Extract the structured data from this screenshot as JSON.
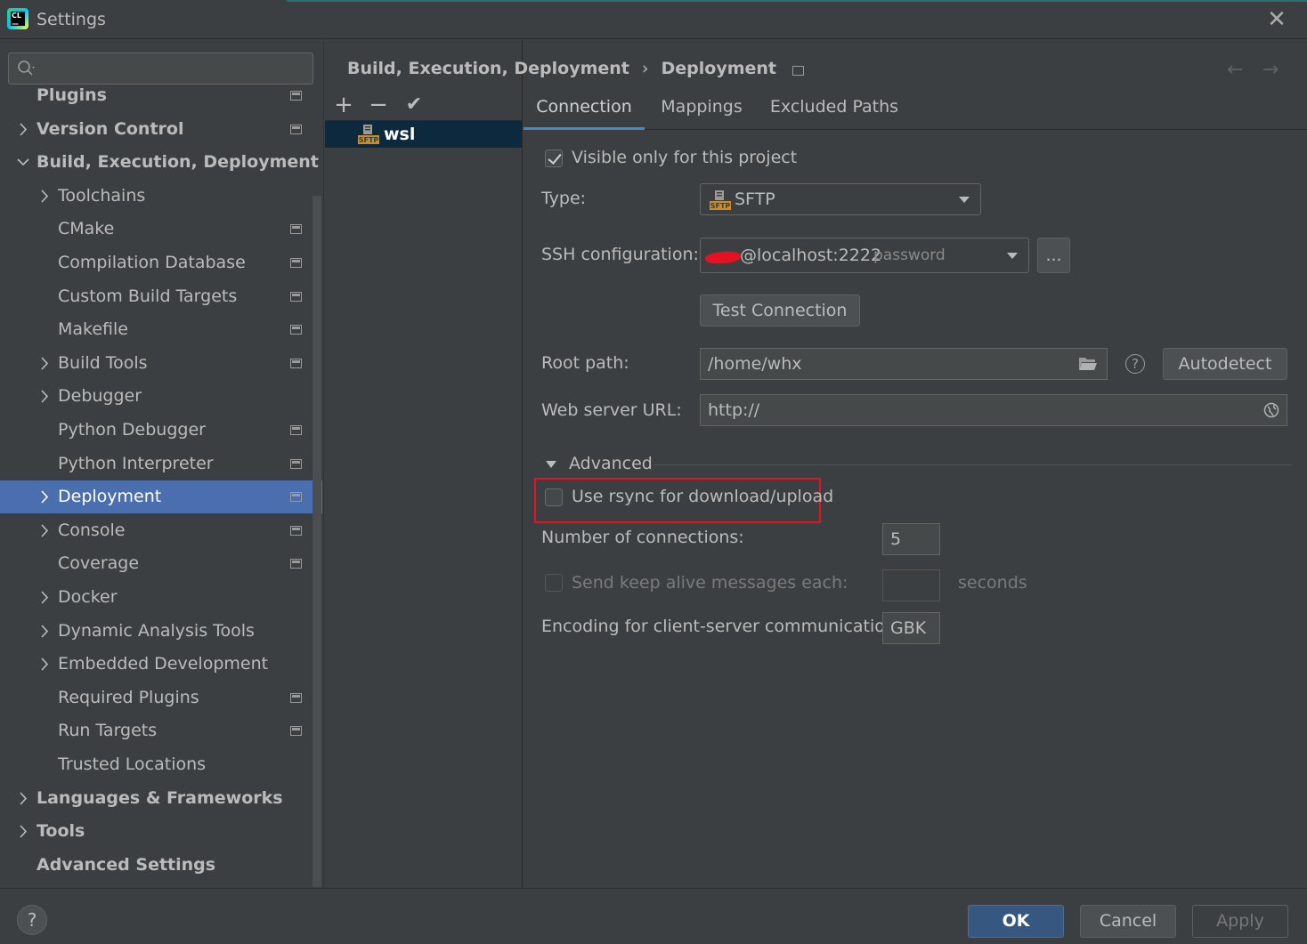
{
  "window": {
    "title": "Settings"
  },
  "search": {
    "placeholder": ""
  },
  "sidebar": {
    "items": [
      {
        "label": "Plugins",
        "level": 0,
        "bold": true,
        "expander": "none",
        "proj": true
      },
      {
        "label": "Version Control",
        "level": 0,
        "bold": true,
        "expander": "collapsed",
        "proj": true
      },
      {
        "label": "Build, Execution, Deployment",
        "level": 0,
        "bold": true,
        "expander": "expanded",
        "proj": false
      },
      {
        "label": "Toolchains",
        "level": 1,
        "bold": false,
        "expander": "collapsed",
        "proj": false
      },
      {
        "label": "CMake",
        "level": 1,
        "bold": false,
        "expander": "none",
        "proj": true
      },
      {
        "label": "Compilation Database",
        "level": 1,
        "bold": false,
        "expander": "none",
        "proj": true
      },
      {
        "label": "Custom Build Targets",
        "level": 1,
        "bold": false,
        "expander": "none",
        "proj": true
      },
      {
        "label": "Makefile",
        "level": 1,
        "bold": false,
        "expander": "none",
        "proj": true
      },
      {
        "label": "Build Tools",
        "level": 1,
        "bold": false,
        "expander": "collapsed",
        "proj": true
      },
      {
        "label": "Debugger",
        "level": 1,
        "bold": false,
        "expander": "collapsed",
        "proj": false
      },
      {
        "label": "Python Debugger",
        "level": 1,
        "bold": false,
        "expander": "none",
        "proj": true
      },
      {
        "label": "Python Interpreter",
        "level": 1,
        "bold": false,
        "expander": "none",
        "proj": true
      },
      {
        "label": "Deployment",
        "level": 1,
        "bold": false,
        "expander": "collapsed",
        "proj": true,
        "selected": true
      },
      {
        "label": "Console",
        "level": 1,
        "bold": false,
        "expander": "collapsed",
        "proj": true
      },
      {
        "label": "Coverage",
        "level": 1,
        "bold": false,
        "expander": "none",
        "proj": true
      },
      {
        "label": "Docker",
        "level": 1,
        "bold": false,
        "expander": "collapsed",
        "proj": false
      },
      {
        "label": "Dynamic Analysis Tools",
        "level": 1,
        "bold": false,
        "expander": "collapsed",
        "proj": false
      },
      {
        "label": "Embedded Development",
        "level": 1,
        "bold": false,
        "expander": "collapsed",
        "proj": false
      },
      {
        "label": "Required Plugins",
        "level": 1,
        "bold": false,
        "expander": "none",
        "proj": true
      },
      {
        "label": "Run Targets",
        "level": 1,
        "bold": false,
        "expander": "none",
        "proj": true
      },
      {
        "label": "Trusted Locations",
        "level": 1,
        "bold": false,
        "expander": "none",
        "proj": false
      },
      {
        "label": "Languages & Frameworks",
        "level": 0,
        "bold": true,
        "expander": "collapsed",
        "proj": false
      },
      {
        "label": "Tools",
        "level": 0,
        "bold": true,
        "expander": "collapsed",
        "proj": false
      },
      {
        "label": "Advanced Settings",
        "level": 0,
        "bold": true,
        "expander": "none",
        "proj": false
      }
    ]
  },
  "breadcrumb": {
    "parent": "Build, Execution, Deployment",
    "separator": "›",
    "current": "Deployment"
  },
  "servers": {
    "toolbar": {
      "add": "+",
      "remove": "−",
      "apply": "✔"
    },
    "items": [
      {
        "name": "wsl",
        "icon": "sftp-icon"
      }
    ]
  },
  "tabs": [
    "Connection",
    "Mappings",
    "Excluded Paths"
  ],
  "connection": {
    "visible_only_label": "Visible only for this project",
    "visible_only_checked": true,
    "type_label": "Type:",
    "type_value": "SFTP",
    "ssh_label": "SSH configuration:",
    "ssh_user_host": "@localhost:2222",
    "ssh_auth": "password",
    "ssh_more_button": "...",
    "test_connection_button": "Test Connection",
    "root_path_label": "Root path:",
    "root_path_value": "/home/whx",
    "autodetect_button": "Autodetect",
    "help_glyph": "?",
    "web_url_label": "Web server URL:",
    "web_url_value": "http://"
  },
  "advanced": {
    "section_label": "Advanced",
    "rsync_label": "Use rsync for download/upload",
    "rsync_checked": false,
    "connections_label": "Number of connections:",
    "connections_value": "5",
    "keepalive_label": "Send keep alive messages each:",
    "keepalive_value": "",
    "keepalive_unit": "seconds",
    "encoding_label": "Encoding for client-server communication:",
    "encoding_value": "GBK"
  },
  "footer": {
    "help": "?",
    "ok": "OK",
    "cancel": "Cancel",
    "apply": "Apply"
  },
  "colors": {
    "accent": "#4b6eaf",
    "highlight_box": "#e81123",
    "ok_button": "#365880"
  }
}
